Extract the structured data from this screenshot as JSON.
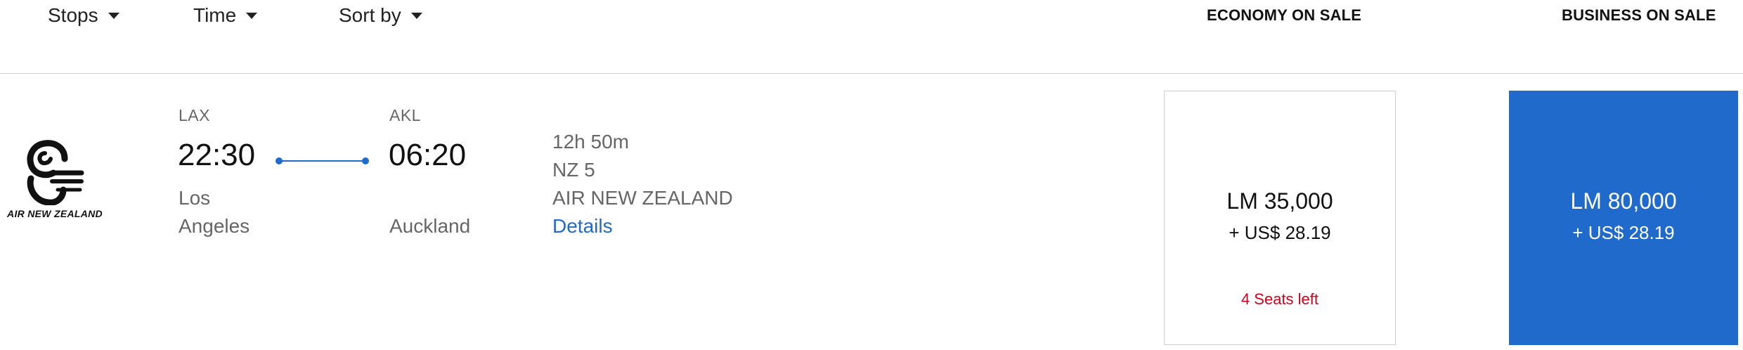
{
  "filters": {
    "stops": "Stops",
    "time": "Time",
    "sort_by": "Sort by"
  },
  "columns": {
    "economy": "ECONOMY ON SALE",
    "business": "BUSINESS ON SALE"
  },
  "flight": {
    "airline_logo_text": "AIR NEW ZEALAND",
    "origin": {
      "code": "LAX",
      "time": "22:30",
      "city_line1": "Los",
      "city_line2": "Angeles"
    },
    "destination": {
      "code": "AKL",
      "time": "06:20",
      "city": "Auckland"
    },
    "duration": "12h 50m",
    "flight_number": "NZ 5",
    "airline": "AIR NEW ZEALAND",
    "details_label": "Details"
  },
  "fares": {
    "economy": {
      "miles": "LM 35,000",
      "cash": "+ US$ 28.19",
      "seats_left": "4 Seats left"
    },
    "business": {
      "miles": "LM 80,000",
      "cash": "+ US$ 28.19"
    }
  },
  "colors": {
    "accent": "#1f6acb",
    "seats_warning": "#d0021b"
  },
  "icons": {
    "filter_caret": "caret-down-icon",
    "logo": "koru-logo"
  }
}
